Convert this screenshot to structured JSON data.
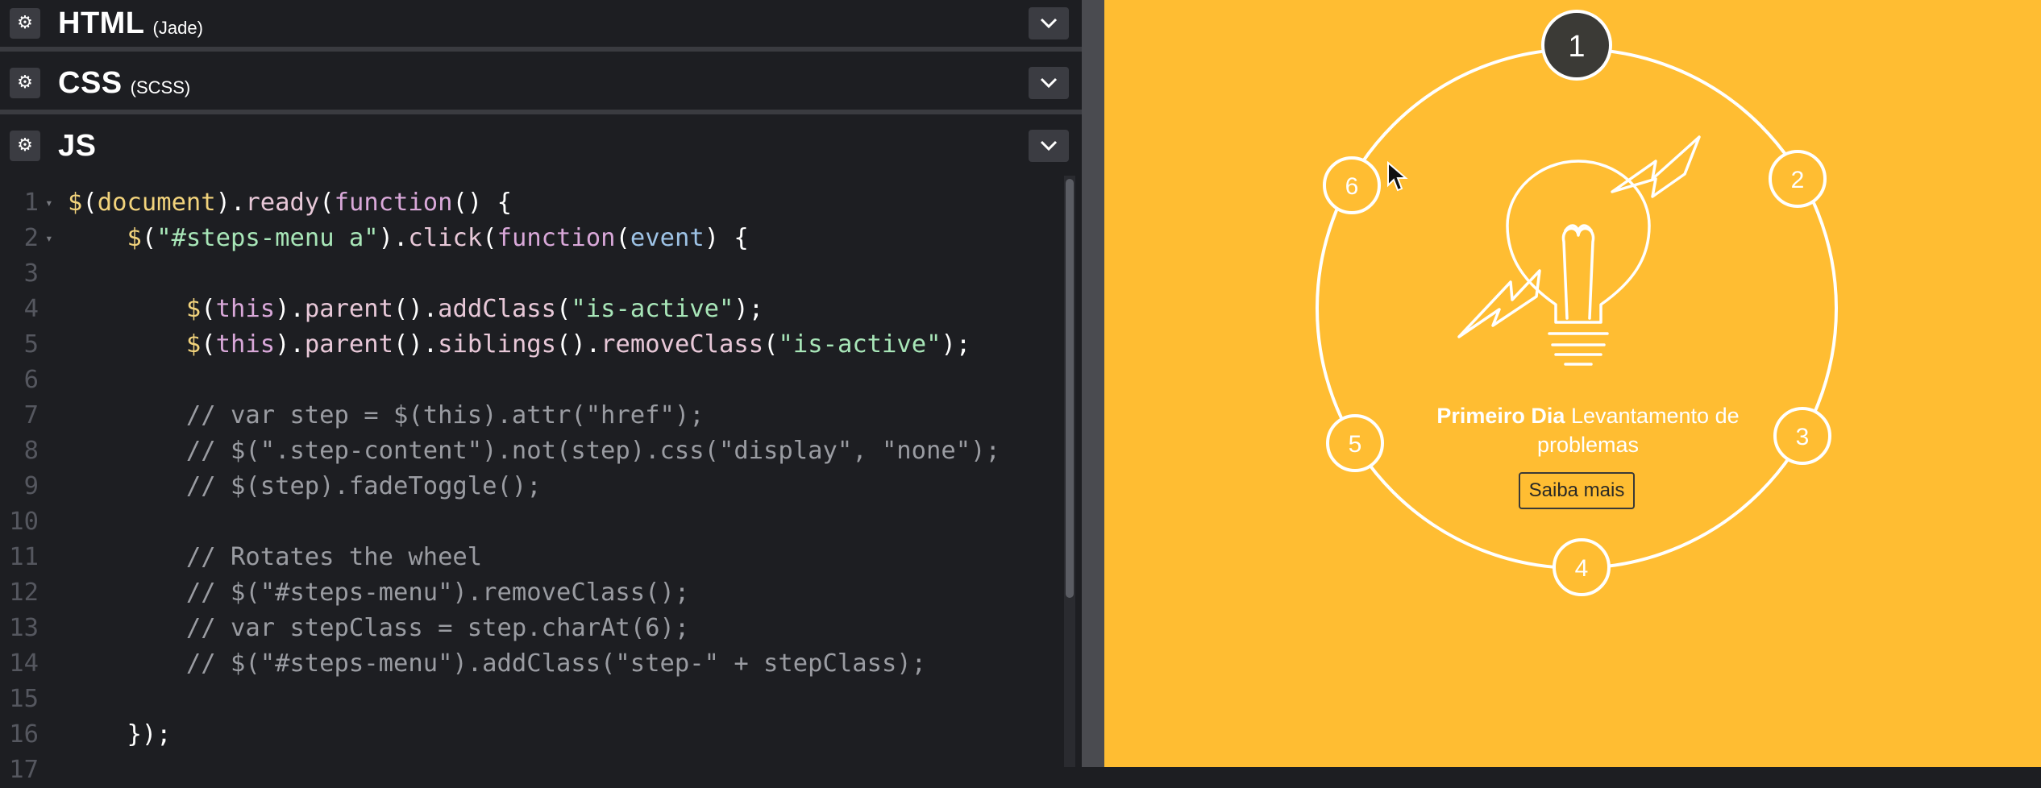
{
  "panels": {
    "html": {
      "title": "HTML",
      "subtitle": "(Jade)"
    },
    "css": {
      "title": "CSS",
      "subtitle": "(SCSS)"
    },
    "js": {
      "title": "JS"
    }
  },
  "code_lines": [
    {
      "num": "1",
      "tokens": [
        [
          "fn",
          "$"
        ],
        [
          "plain",
          "("
        ],
        [
          "fn",
          "document"
        ],
        [
          "plain",
          ")."
        ],
        [
          "method",
          "ready"
        ],
        [
          "plain",
          "("
        ],
        [
          "kw",
          "function"
        ],
        [
          "plain",
          "() {"
        ]
      ]
    },
    {
      "num": "2",
      "tokens": [
        [
          "plain",
          "    "
        ],
        [
          "fn",
          "$"
        ],
        [
          "plain",
          "("
        ],
        [
          "str",
          "\"#steps-menu a\""
        ],
        [
          "plain",
          ")."
        ],
        [
          "method",
          "click"
        ],
        [
          "plain",
          "("
        ],
        [
          "kw",
          "function"
        ],
        [
          "plain",
          "("
        ],
        [
          "var",
          "event"
        ],
        [
          "plain",
          ") {"
        ]
      ]
    },
    {
      "num": "3",
      "tokens": []
    },
    {
      "num": "4",
      "tokens": [
        [
          "plain",
          "        "
        ],
        [
          "fn",
          "$"
        ],
        [
          "plain",
          "("
        ],
        [
          "kw",
          "this"
        ],
        [
          "plain",
          ")."
        ],
        [
          "method",
          "parent"
        ],
        [
          "plain",
          "()."
        ],
        [
          "method",
          "addClass"
        ],
        [
          "plain",
          "("
        ],
        [
          "str",
          "\"is-active\""
        ],
        [
          "plain",
          ");"
        ]
      ]
    },
    {
      "num": "5",
      "tokens": [
        [
          "plain",
          "        "
        ],
        [
          "fn",
          "$"
        ],
        [
          "plain",
          "("
        ],
        [
          "kw",
          "this"
        ],
        [
          "plain",
          ")."
        ],
        [
          "method",
          "parent"
        ],
        [
          "plain",
          "()."
        ],
        [
          "method",
          "siblings"
        ],
        [
          "plain",
          "()."
        ],
        [
          "method",
          "removeClass"
        ],
        [
          "plain",
          "("
        ],
        [
          "str",
          "\"is-active\""
        ],
        [
          "plain",
          ");"
        ]
      ]
    },
    {
      "num": "6",
      "tokens": []
    },
    {
      "num": "7",
      "tokens": [
        [
          "plain",
          "        "
        ],
        [
          "com",
          "// var step = $(this).attr(\"href\");"
        ]
      ]
    },
    {
      "num": "8",
      "tokens": [
        [
          "plain",
          "        "
        ],
        [
          "com",
          "// $(\".step-content\").not(step).css(\"display\", \"none\");"
        ]
      ]
    },
    {
      "num": "9",
      "tokens": [
        [
          "plain",
          "        "
        ],
        [
          "com",
          "// $(step).fadeToggle();"
        ]
      ]
    },
    {
      "num": "10",
      "tokens": []
    },
    {
      "num": "11",
      "tokens": [
        [
          "plain",
          "        "
        ],
        [
          "com",
          "// Rotates the wheel"
        ]
      ]
    },
    {
      "num": "12",
      "tokens": [
        [
          "plain",
          "        "
        ],
        [
          "com",
          "// $(\"#steps-menu\").removeClass();"
        ]
      ]
    },
    {
      "num": "13",
      "tokens": [
        [
          "plain",
          "        "
        ],
        [
          "com",
          "// var stepClass = step.charAt(6);"
        ]
      ]
    },
    {
      "num": "14",
      "tokens": [
        [
          "plain",
          "        "
        ],
        [
          "com",
          "// $(\"#steps-menu\").addClass(\"step-\" + stepClass);"
        ]
      ]
    },
    {
      "num": "15",
      "tokens": []
    },
    {
      "num": "16",
      "tokens": [
        [
          "plain",
          "    });"
        ]
      ]
    },
    {
      "num": "17",
      "tokens": []
    }
  ],
  "fold_lines": [
    "1",
    "2"
  ],
  "preview": {
    "steps": [
      "1",
      "2",
      "3",
      "4",
      "5",
      "6"
    ],
    "active_step": "1",
    "title_bold": "Primeiro Dia",
    "title_rest": "Levantamento de problemas",
    "button_label": "Saiba mais"
  },
  "colors": {
    "editor_bg": "#1d1e22",
    "preview_bg": "#ffbd32",
    "active_step_bg": "#3b3a36"
  }
}
